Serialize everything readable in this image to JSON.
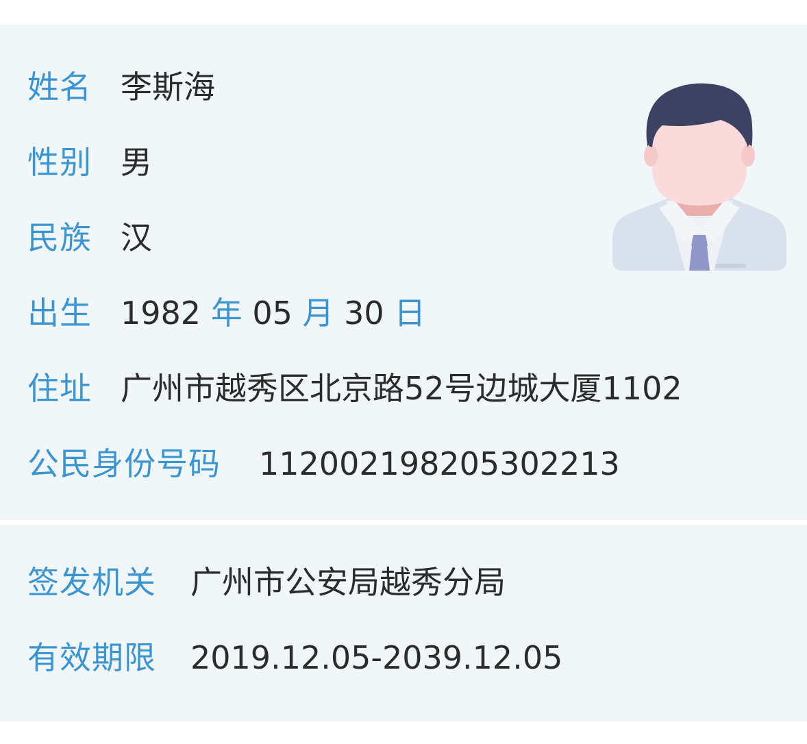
{
  "identity": {
    "name_label": "姓名",
    "name_value": "李斯海",
    "gender_label": "性别",
    "gender_value": "男",
    "ethnicity_label": "民族",
    "ethnicity_value": "汉",
    "birth_label": "出生",
    "birth_year": "1982",
    "birth_year_unit": "年",
    "birth_month": "05",
    "birth_month_unit": "月",
    "birth_day": "30",
    "birth_day_unit": "日",
    "address_label": "住址",
    "address_value": "广州市越秀区北京路52号边城大厦1102",
    "id_label": "公民身份号码",
    "id_value": "112002198205302213"
  },
  "issuance": {
    "authority_label": "签发机关",
    "authority_value": "广州市公安局越秀分局",
    "validity_label": "有效期限",
    "validity_value": "2019.12.05-2039.12.05"
  },
  "icons": {
    "avatar": "male-avatar-icon"
  },
  "colors": {
    "label": "#3a95d1",
    "value": "#2b2b2b",
    "panel": "#f1f6f9"
  }
}
